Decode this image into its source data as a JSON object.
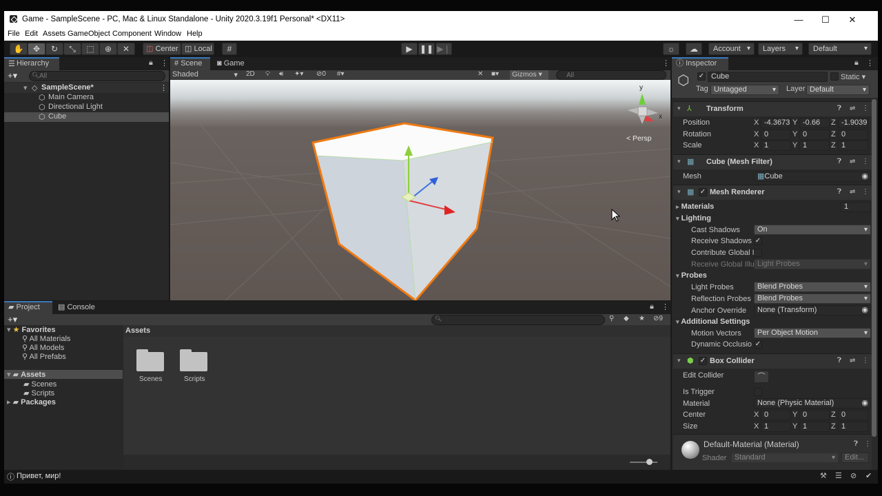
{
  "window": {
    "title": "Game - SampleScene - PC, Mac & Linux Standalone - Unity 2020.3.19f1 Personal* <DX11>",
    "minimize": "—",
    "maximize": "☐",
    "close": "✕"
  },
  "menu": [
    "File",
    "Edit",
    "Assets",
    "GameObject",
    "Component",
    "Window",
    "Help"
  ],
  "toolbar": {
    "pivot": "Center",
    "space": "Local",
    "account": "Account",
    "layers": "Layers",
    "layout": "Default"
  },
  "hierarchy": {
    "tab": "Hierarchy",
    "search_placeholder": "All",
    "scene": "SampleScene*",
    "items": [
      "Main Camera",
      "Directional Light",
      "Cube"
    ]
  },
  "scene_view": {
    "tabs": [
      "Scene",
      "Game"
    ],
    "shading": "Shaded",
    "mode2d": "2D",
    "hidden_count": "0",
    "gizmos": "Gizmos",
    "search_placeholder": "All",
    "persp": "< Persp",
    "axis_y": "y",
    "axis_x": "x"
  },
  "project": {
    "tabs": [
      "Project",
      "Console"
    ],
    "favorites": "Favorites",
    "fav_items": [
      "All Materials",
      "All Models",
      "All Prefabs"
    ],
    "assets": "Assets",
    "asset_children": [
      "Scenes",
      "Scripts"
    ],
    "packages": "Packages",
    "breadcrumb": "Assets",
    "folders": [
      "Scenes",
      "Scripts"
    ],
    "hidden_count": "9"
  },
  "inspector": {
    "tab": "Inspector",
    "object_name": "Cube",
    "static": "Static",
    "tag_label": "Tag",
    "tag_value": "Untagged",
    "layer_label": "Layer",
    "layer_value": "Default",
    "transform": {
      "title": "Transform",
      "position": "Position",
      "rotation": "Rotation",
      "scale": "Scale",
      "pos": [
        "-4.3673",
        "-0.66",
        "-1.9039"
      ],
      "rot": [
        "0",
        "0",
        "0"
      ],
      "scl": [
        "1",
        "1",
        "1"
      ]
    },
    "axes": [
      "X",
      "Y",
      "Z"
    ],
    "mesh_filter": {
      "title": "Cube (Mesh Filter)",
      "mesh_label": "Mesh",
      "mesh_value": "Cube"
    },
    "mesh_renderer": {
      "title": "Mesh Renderer",
      "materials": "Materials",
      "materials_count": "1",
      "lighting": "Lighting",
      "cast_shadows": "Cast Shadows",
      "cast_shadows_value": "On",
      "receive_shadows": "Receive Shadows",
      "contribute_gi": "Contribute Global I",
      "receive_gi": "Receive Global Illu",
      "receive_gi_value": "Light Probes",
      "probes": "Probes",
      "light_probes": "Light Probes",
      "light_probes_value": "Blend Probes",
      "reflection_probes": "Reflection Probes",
      "reflection_probes_value": "Blend Probes",
      "anchor_override": "Anchor Override",
      "anchor_override_value": "None (Transform)",
      "additional": "Additional Settings",
      "motion_vectors": "Motion Vectors",
      "motion_vectors_value": "Per Object Motion",
      "dynamic_occlusion": "Dynamic Occlusio"
    },
    "box_collider": {
      "title": "Box Collider",
      "edit_collider": "Edit Collider",
      "is_trigger": "Is Trigger",
      "material": "Material",
      "material_value": "None (Physic Material)",
      "center": "Center",
      "center_vals": [
        "0",
        "0",
        "0"
      ],
      "size": "Size",
      "size_vals": [
        "1",
        "1",
        "1"
      ]
    },
    "material": {
      "title": "Default-Material (Material)",
      "shader_label": "Shader",
      "shader_value": "Standard",
      "edit": "Edit..."
    }
  },
  "status": {
    "message": "Привет, мир!"
  }
}
